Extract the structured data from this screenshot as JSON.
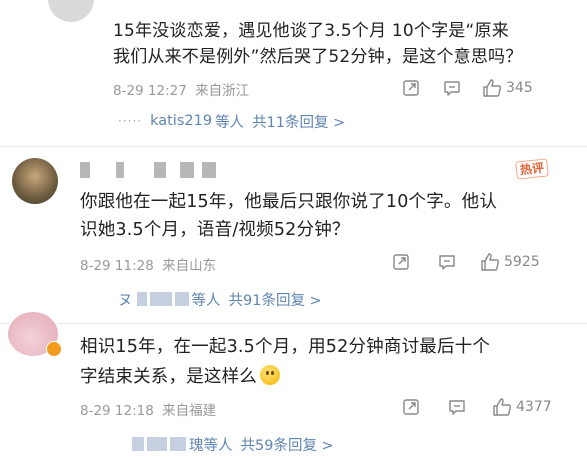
{
  "comments": [
    {
      "text_lines": [
        "15年没谈恋爱，遇见他谈了3.5个月 10个字是“原来",
        "我们从来不是例外”然后哭了52分钟，是这个意思吗？"
      ],
      "time": "8-29 12:27",
      "location": "来自浙江",
      "likes": "345",
      "replies_user": "katis219",
      "replies_suffix": "等人",
      "replies_count": "共11条回复 >"
    },
    {
      "badge": "热评",
      "text_lines": [
        "你跟他在一起15年，他最后只跟你说了10个字。他认",
        "识她3.5个月，语音/视频52分钟？"
      ],
      "time": "8-29 11:28",
      "location": "来自山东",
      "likes": "5925",
      "replies_user_prefix": "ヌ",
      "replies_suffix": "等人",
      "replies_count": "共91条回复 >"
    },
    {
      "text_lines": [
        "相识15年，在一起3.5个月，用52分钟商讨最后十个",
        "字结束关系，是这样么"
      ],
      "time": "8-29 12:18",
      "location": "来自福建",
      "likes": "4377",
      "replies_user_suffix": "瑰",
      "replies_suffix": "等人",
      "replies_count": "共59条回复 >"
    }
  ],
  "colors": {
    "link": "#5f85b2",
    "meta": "#9a9a9a",
    "text": "#222222",
    "hot": "#e8623a"
  },
  "icons": [
    "share-icon",
    "comment-icon",
    "like-icon"
  ]
}
